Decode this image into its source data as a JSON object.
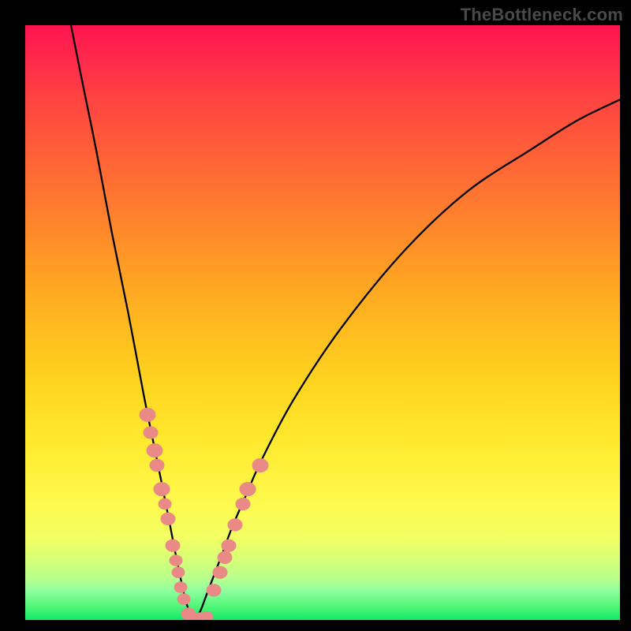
{
  "watermark": "TheBottleneck.com",
  "chart_data": {
    "type": "line",
    "title": "",
    "xlabel": "",
    "ylabel": "",
    "xlim": [
      0,
      754
    ],
    "ylim_percent": [
      0,
      100
    ],
    "description": "Bottleneck curve: two black lines form a V dipping to the green (low-bottleneck) zone near x≈215. Gradient background encodes bottleneck % from ~100 (top, red) to ~0 (bottom, green). Pink dots mark sampled points near the trough.",
    "series": [
      {
        "name": "left-curve",
        "x": [
          58,
          70,
          90,
          110,
          130,
          150,
          163,
          173,
          182,
          190,
          197,
          203,
          209,
          215
        ],
        "y_percent": [
          100,
          92,
          79,
          65,
          52,
          38,
          29.5,
          23,
          17,
          11.5,
          7,
          3.5,
          1,
          0
        ]
      },
      {
        "name": "right-curve",
        "x": [
          215,
          222,
          232,
          248,
          262,
          280,
          300,
          340,
          400,
          480,
          560,
          640,
          700,
          754
        ],
        "y_percent": [
          0,
          1.5,
          5,
          10.5,
          15.5,
          21,
          27,
          37,
          49,
          62,
          72,
          79,
          84,
          87.5
        ]
      }
    ],
    "dots": [
      {
        "x": 155,
        "y_percent": 34.5,
        "r": 10
      },
      {
        "x": 159,
        "y_percent": 31.5,
        "r": 9
      },
      {
        "x": 164,
        "y_percent": 28.5,
        "r": 10
      },
      {
        "x": 167,
        "y_percent": 26.0,
        "r": 9
      },
      {
        "x": 173,
        "y_percent": 22.0,
        "r": 10
      },
      {
        "x": 177,
        "y_percent": 19.5,
        "r": 8
      },
      {
        "x": 181,
        "y_percent": 17.0,
        "r": 9
      },
      {
        "x": 187,
        "y_percent": 12.5,
        "r": 9
      },
      {
        "x": 191,
        "y_percent": 10.0,
        "r": 8
      },
      {
        "x": 194,
        "y_percent": 8.0,
        "r": 8
      },
      {
        "x": 197,
        "y_percent": 5.5,
        "r": 8
      },
      {
        "x": 201,
        "y_percent": 3.5,
        "r": 8
      },
      {
        "x": 207,
        "y_percent": 1.0,
        "r": 9
      },
      {
        "x": 213,
        "y_percent": 0.2,
        "r": 9
      },
      {
        "x": 222,
        "y_percent": 0.2,
        "r": 9
      },
      {
        "x": 230,
        "y_percent": 0.5,
        "r": 8
      },
      {
        "x": 239,
        "y_percent": 5.0,
        "r": 9
      },
      {
        "x": 247,
        "y_percent": 8.0,
        "r": 9
      },
      {
        "x": 253,
        "y_percent": 10.5,
        "r": 9
      },
      {
        "x": 258,
        "y_percent": 12.5,
        "r": 9
      },
      {
        "x": 266,
        "y_percent": 16.0,
        "r": 9
      },
      {
        "x": 276,
        "y_percent": 19.5,
        "r": 9
      },
      {
        "x": 282,
        "y_percent": 22.0,
        "r": 10
      },
      {
        "x": 298,
        "y_percent": 26.0,
        "r": 10
      }
    ]
  }
}
